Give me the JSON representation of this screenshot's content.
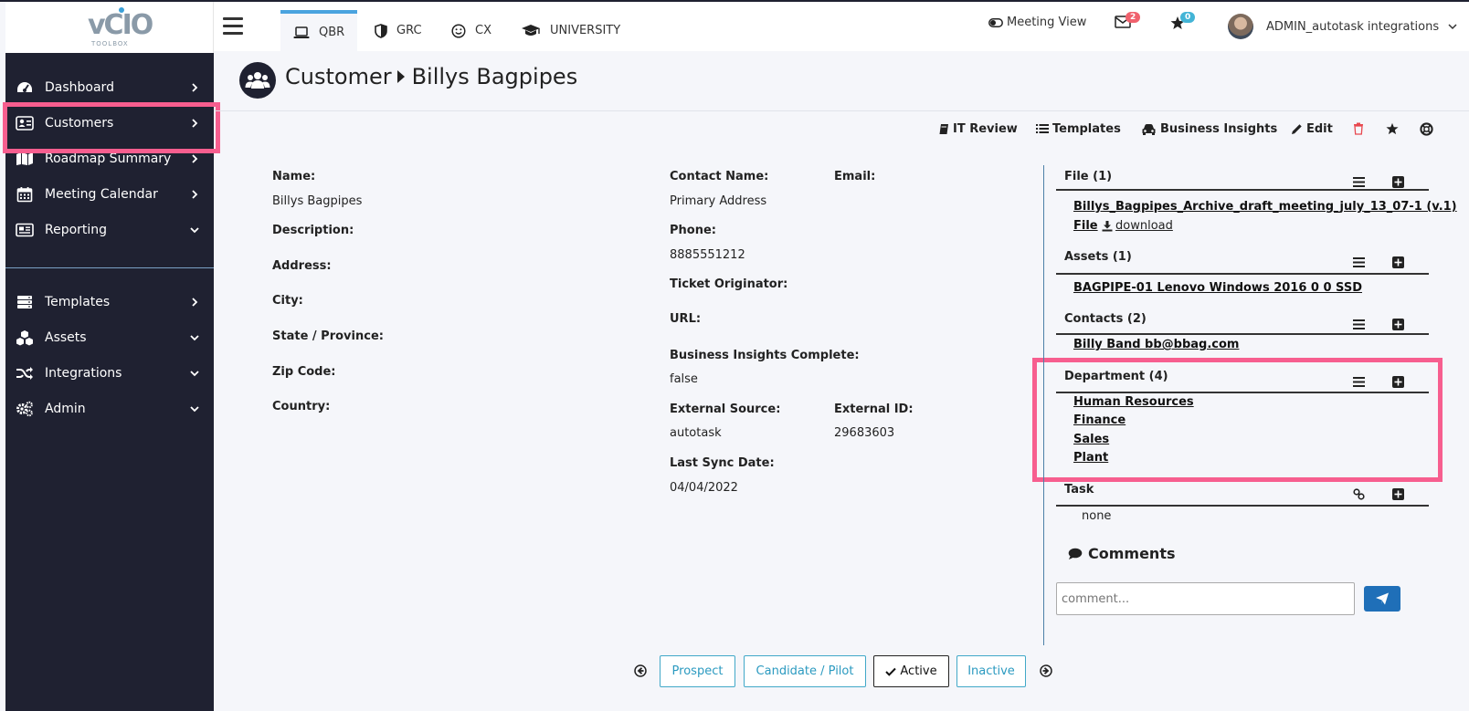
{
  "sidebar": {
    "items": [
      {
        "label": "Dashboard"
      },
      {
        "label": "Customers"
      },
      {
        "label": "Roadmap Summary"
      },
      {
        "label": "Meeting Calendar"
      },
      {
        "label": "Reporting"
      },
      {
        "label": "Templates"
      },
      {
        "label": "Assets"
      },
      {
        "label": "Integrations"
      },
      {
        "label": "Admin"
      }
    ]
  },
  "logo": {
    "big": "vCIO",
    "small": "TOOLBOX"
  },
  "topnav": {
    "tabs": [
      {
        "label": "QBR"
      },
      {
        "label": "GRC"
      },
      {
        "label": "CX"
      },
      {
        "label": "UNIVERSITY"
      }
    ],
    "meeting_view": "Meeting View",
    "mail_count": "2",
    "star_count": "0",
    "user_name": "ADMIN_autotask integrations"
  },
  "header": {
    "section": "Customer",
    "name": "Billys Bagpipes"
  },
  "toolbar": {
    "it_review": "IT Review",
    "templates": "Templates",
    "business_insights": "Business Insights",
    "edit": "Edit"
  },
  "fields": {
    "name_label": "Name:",
    "name_value": "Billys Bagpipes",
    "description_label": "Description:",
    "address_label": "Address:",
    "city_label": "City:",
    "state_label": "State / Province:",
    "zip_label": "Zip Code:",
    "country_label": "Country:",
    "contact_name_label": "Contact Name:",
    "contact_name_value": "Primary Address",
    "email_label": "Email:",
    "phone_label": "Phone:",
    "phone_value": "8885551212",
    "ticket_label": "Ticket Originator:",
    "url_label": "URL:",
    "bi_complete_label": "Business Insights Complete:",
    "bi_complete_value": "false",
    "ext_source_label": "External Source:",
    "ext_source_value": "autotask",
    "ext_id_label": "External ID:",
    "ext_id_value": "29683603",
    "last_sync_label": "Last Sync Date:",
    "last_sync_value": "04/04/2022"
  },
  "panel": {
    "file_title": "File (1)",
    "file_name": "Billys_Bagpipes_Archive_draft_meeting_july_13_07-1 (v.1)",
    "file_type": "File",
    "file_download": "download",
    "assets_title": "Assets (1)",
    "asset_item": "BAGPIPE-01 Lenovo  Windows 2016  0 0 SSD",
    "contacts_title": "Contacts (2)",
    "contact_item": "Billy Band bb@bbag.com",
    "department_title": "Department (4)",
    "departments": [
      "Human Resources",
      "Finance",
      "Sales",
      "Plant"
    ],
    "task_title": "Task",
    "task_none": "none",
    "comments_title": "Comments",
    "comment_placeholder": "comment..."
  },
  "status": {
    "prospect": "Prospect",
    "candidate": "Candidate / Pilot",
    "active": "Active",
    "inactive": "Inactive"
  },
  "colors": {
    "sidebar_bg": "#1f2131",
    "highlight": "#f75e8f",
    "accent": "#4aa3df",
    "send_button": "#1f6fb8",
    "mail_badge": "#f0616d",
    "star_badge": "#43b4d6"
  }
}
